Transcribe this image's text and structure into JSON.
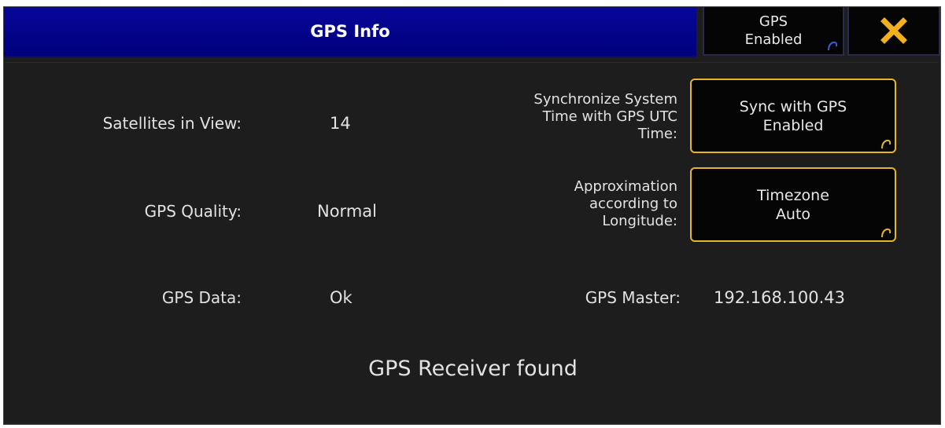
{
  "window": {
    "title": "GPS Info",
    "gps_toggle_line1": "GPS",
    "gps_toggle_line2": "Enabled",
    "close_icon": "close-x-icon"
  },
  "info": {
    "satellites_label": "Satellites in View:",
    "satellites_value": "14",
    "quality_label": "GPS Quality:",
    "quality_value": "Normal",
    "data_label": "GPS Data:",
    "data_value": "Ok",
    "master_label": "GPS Master:",
    "master_value": "192.168.100.43"
  },
  "sync": {
    "label": "Synchronize System\nTime with GPS UTC\nTime:",
    "button_line1": "Sync with GPS",
    "button_line2": "Enabled"
  },
  "timezone": {
    "label": "Approximation\naccording to\nLongitude:",
    "button_line1": "Timezone",
    "button_line2": "Auto"
  },
  "status": "GPS Receiver found",
  "colors": {
    "title_bar": "#00007d",
    "background": "#1d1d1d",
    "button_border": "#e2b72a",
    "close_icon": "#f2b01e",
    "corner_hook": "#e2b72a",
    "corner_hook_title": "#3b5bd0"
  }
}
